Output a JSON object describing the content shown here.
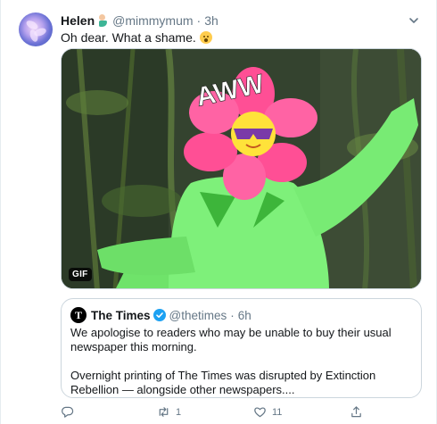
{
  "tweet": {
    "author_name": "Helen",
    "author_handle": "@mimmymum",
    "separator": "·",
    "time": "3h",
    "text": "Oh dear. What a shame."
  },
  "media": {
    "badge": "GIF",
    "overlay_text": "AWW"
  },
  "quoted": {
    "name": "The Times",
    "handle": "@thetimes",
    "separator": "·",
    "time": "6h",
    "logo_letter": "T",
    "paragraph1": "We apologise to readers who may be unable to buy their usual newspaper this morning.",
    "paragraph2": "Overnight printing of The Times was disrupted by Extinction Rebellion — alongside other newspapers...."
  },
  "actions": {
    "reply_count": "",
    "retweet_count": "1",
    "like_count": "11"
  },
  "colors": {
    "muted": "#657786",
    "accent": "#1da1f2",
    "border": "#ccd6dd"
  },
  "icons": [
    "chevron-down-icon",
    "verified-icon",
    "reply-icon",
    "retweet-icon",
    "like-icon",
    "share-icon"
  ]
}
